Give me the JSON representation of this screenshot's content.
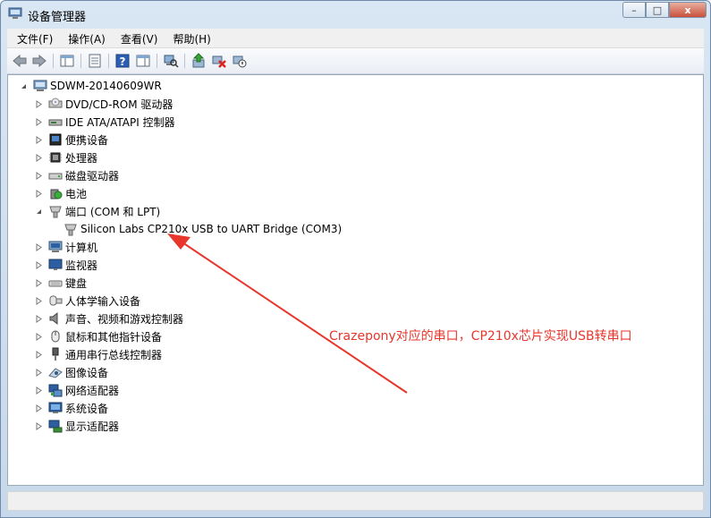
{
  "window": {
    "title": "设备管理器",
    "controls": {
      "minimize": "–",
      "maximize": "□",
      "close": "x"
    }
  },
  "menu": [
    {
      "label": "文件(F)"
    },
    {
      "label": "操作(A)"
    },
    {
      "label": "查看(V)"
    },
    {
      "label": "帮助(H)"
    }
  ],
  "toolbar": [
    {
      "icon": "back-arrow-icon"
    },
    {
      "icon": "forward-arrow-icon"
    },
    {
      "icon": "show-hide-console-tree-icon"
    },
    {
      "icon": "properties-icon"
    },
    {
      "icon": "help-icon"
    },
    {
      "icon": "action-pane-icon"
    },
    {
      "icon": "scan-hardware-changes-icon"
    },
    {
      "icon": "update-driver-icon"
    },
    {
      "icon": "uninstall-icon"
    },
    {
      "icon": "disable-device-icon"
    }
  ],
  "tree": {
    "root": "SDWM-20140609WR",
    "items": [
      {
        "label": "DVD/CD-ROM 驱动器",
        "icon": "dvd-drive-icon",
        "expanded": false
      },
      {
        "label": "IDE ATA/ATAPI 控制器",
        "icon": "ide-controller-icon",
        "expanded": false
      },
      {
        "label": "便携设备",
        "icon": "portable-device-icon",
        "expanded": false
      },
      {
        "label": "处理器",
        "icon": "processor-icon",
        "expanded": false
      },
      {
        "label": "磁盘驱动器",
        "icon": "disk-drive-icon",
        "expanded": false
      },
      {
        "label": "电池",
        "icon": "battery-icon",
        "expanded": false
      },
      {
        "label": "端口 (COM 和 LPT)",
        "icon": "port-icon",
        "expanded": true,
        "children": [
          {
            "label": "Silicon Labs CP210x USB to UART Bridge (COM3)",
            "icon": "port-icon"
          }
        ]
      },
      {
        "label": "计算机",
        "icon": "computer-icon",
        "expanded": false
      },
      {
        "label": "监视器",
        "icon": "monitor-icon",
        "expanded": false
      },
      {
        "label": "键盘",
        "icon": "keyboard-icon",
        "expanded": false
      },
      {
        "label": "人体学输入设备",
        "icon": "hid-icon",
        "expanded": false
      },
      {
        "label": "声音、视频和游戏控制器",
        "icon": "sound-icon",
        "expanded": false
      },
      {
        "label": "鼠标和其他指针设备",
        "icon": "mouse-icon",
        "expanded": false
      },
      {
        "label": "通用串行总线控制器",
        "icon": "usb-icon",
        "expanded": false
      },
      {
        "label": "图像设备",
        "icon": "camera-icon",
        "expanded": false
      },
      {
        "label": "网络适配器",
        "icon": "network-adapter-icon",
        "expanded": false
      },
      {
        "label": "系统设备",
        "icon": "system-device-icon",
        "expanded": false
      },
      {
        "label": "显示适配器",
        "icon": "display-adapter-icon",
        "expanded": false
      }
    ]
  },
  "annotation": {
    "text": "Crazepony对应的串口，CP210x芯片实现USB转串口",
    "color": "#e8362c"
  }
}
